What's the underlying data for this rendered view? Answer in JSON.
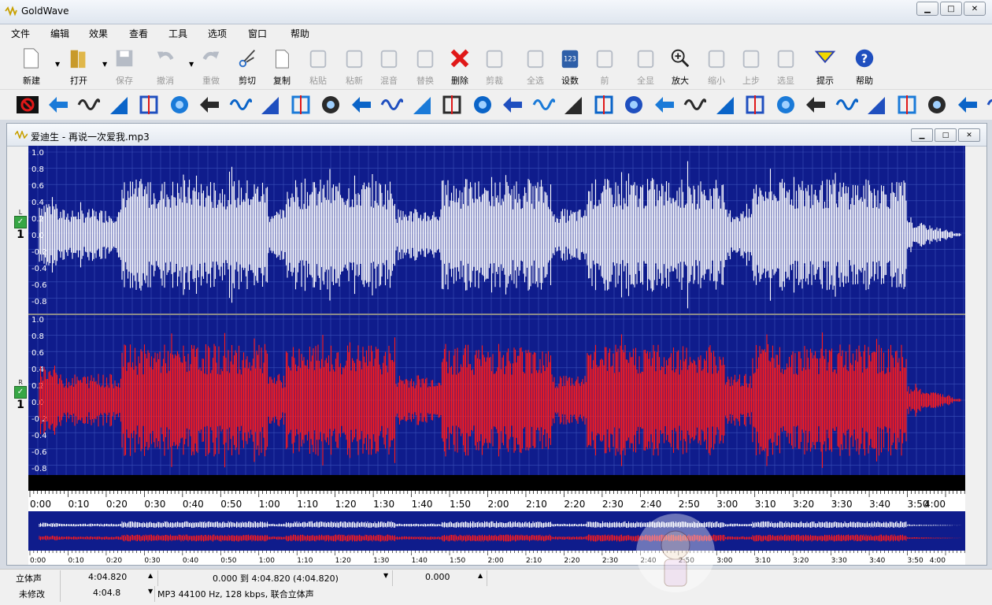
{
  "app": {
    "title": "GoldWave"
  },
  "menu": [
    "文件",
    "编辑",
    "效果",
    "查看",
    "工具",
    "选项",
    "窗口",
    "帮助"
  ],
  "toolbar": [
    {
      "label": "新建",
      "icon": "new-file-icon",
      "disabled": false
    },
    {
      "label": "打开",
      "icon": "open-folder-icon",
      "disabled": false
    },
    {
      "label": "保存",
      "icon": "save-icon",
      "disabled": true
    },
    {
      "label": "撤消",
      "icon": "undo-icon",
      "disabled": true
    },
    {
      "label": "重做",
      "icon": "redo-icon",
      "disabled": true
    },
    {
      "label": "剪切",
      "icon": "scissors-icon",
      "disabled": false
    },
    {
      "label": "复制",
      "icon": "copy-icon",
      "disabled": false
    },
    {
      "label": "粘贴",
      "icon": "paste-icon",
      "disabled": true
    },
    {
      "label": "粘新",
      "icon": "paste-new-icon",
      "disabled": true
    },
    {
      "label": "混音",
      "icon": "mix-icon",
      "disabled": true
    },
    {
      "label": "替换",
      "icon": "replace-icon",
      "disabled": true
    },
    {
      "label": "删除",
      "icon": "delete-icon",
      "disabled": false
    },
    {
      "label": "剪裁",
      "icon": "trim-icon",
      "disabled": true
    },
    {
      "label": "全选",
      "icon": "select-all-icon",
      "disabled": true
    },
    {
      "label": "设数",
      "icon": "set-values-icon",
      "disabled": false
    },
    {
      "label": "前",
      "icon": "previous-icon",
      "disabled": true
    },
    {
      "label": "全显",
      "icon": "zoom-all-icon",
      "disabled": true
    },
    {
      "label": "放大",
      "icon": "zoom-in-icon",
      "disabled": false
    },
    {
      "label": "缩小",
      "icon": "zoom-out-icon",
      "disabled": true
    },
    {
      "label": "上步",
      "icon": "zoom-previous-icon",
      "disabled": true
    },
    {
      "label": "选显",
      "icon": "zoom-selection-icon",
      "disabled": true
    },
    {
      "label": "提示",
      "icon": "cue-icon",
      "disabled": false
    },
    {
      "label": "帮助",
      "icon": "help-icon",
      "disabled": false
    }
  ],
  "effects_count": 33,
  "document": {
    "title": "爱迪生 - 再说一次爱我.mp3"
  },
  "channels": [
    {
      "letter": "L",
      "num": "1",
      "color": "#ffffff"
    },
    {
      "letter": "R",
      "num": "1",
      "color": "#ff0000"
    }
  ],
  "amplitude_labels": [
    "1.0",
    "0.8",
    "0.6",
    "0.4",
    "0.2",
    "0.0",
    "-0.2",
    "-0.4",
    "-0.6",
    "-0.8"
  ],
  "time_labels": [
    "0:00",
    "0:10",
    "0:20",
    "0:30",
    "0:40",
    "0:50",
    "1:00",
    "1:10",
    "1:20",
    "1:30",
    "1:40",
    "1:50",
    "2:00",
    "2:10",
    "2:20",
    "2:30",
    "2:40",
    "2:50",
    "3:00",
    "3:10",
    "3:20",
    "3:30",
    "3:40",
    "3:50",
    "4:00"
  ],
  "status": {
    "row1": {
      "channels": "立体声",
      "length": "4:04.820",
      "selection": "0.000 到 4:04.820 (4:04.820)",
      "position": "0.000"
    },
    "row2": {
      "modified": "未修改",
      "length": "4:04.8",
      "format": "MP3 44100 Hz, 128 kbps, 联合立体声"
    }
  },
  "colors": {
    "wave_bg": "#0f1c8c",
    "left": "#ffffff",
    "right": "#ff1a1a",
    "grid": "#3a4fb8"
  }
}
